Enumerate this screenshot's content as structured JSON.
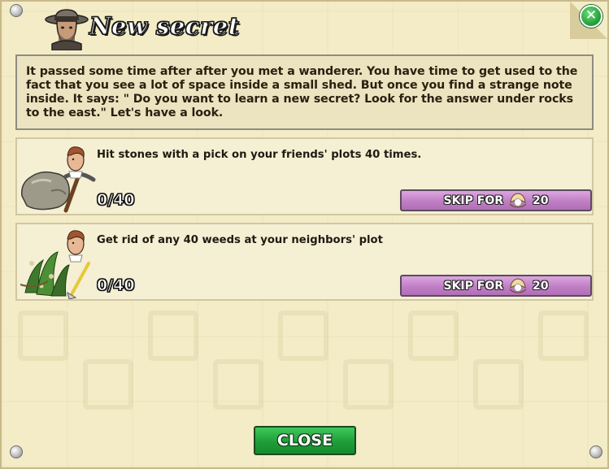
{
  "dialog": {
    "title": "New secret",
    "story": "It passed some time after after you met a wanderer. You have time to get used to the fact that you see a lot of space inside a small shed. But once you find a strange note inside. It says: \" Do you want to learn a new secret? Look for the answer under rocks to the east.\" Let's have a look.",
    "close_label": "CLOSE"
  },
  "tasks": [
    {
      "description": "Hit stones with a pick on your friends' plots 40 times.",
      "progress": "0/40",
      "skip_label": "SKIP FOR",
      "skip_cost": "20",
      "icon": "stones-pickaxe-icon"
    },
    {
      "description": "Get rid of any 40 weeds at your neighbors' plot",
      "progress": "0/40",
      "skip_label": "SKIP FOR",
      "skip_cost": "20",
      "icon": "weeds-icon"
    }
  ],
  "colors": {
    "panel_background": "#f3ecc6",
    "skip_button": "#c07ec5",
    "close_button": "#1f9e38",
    "close_x": "#1d9a36"
  }
}
